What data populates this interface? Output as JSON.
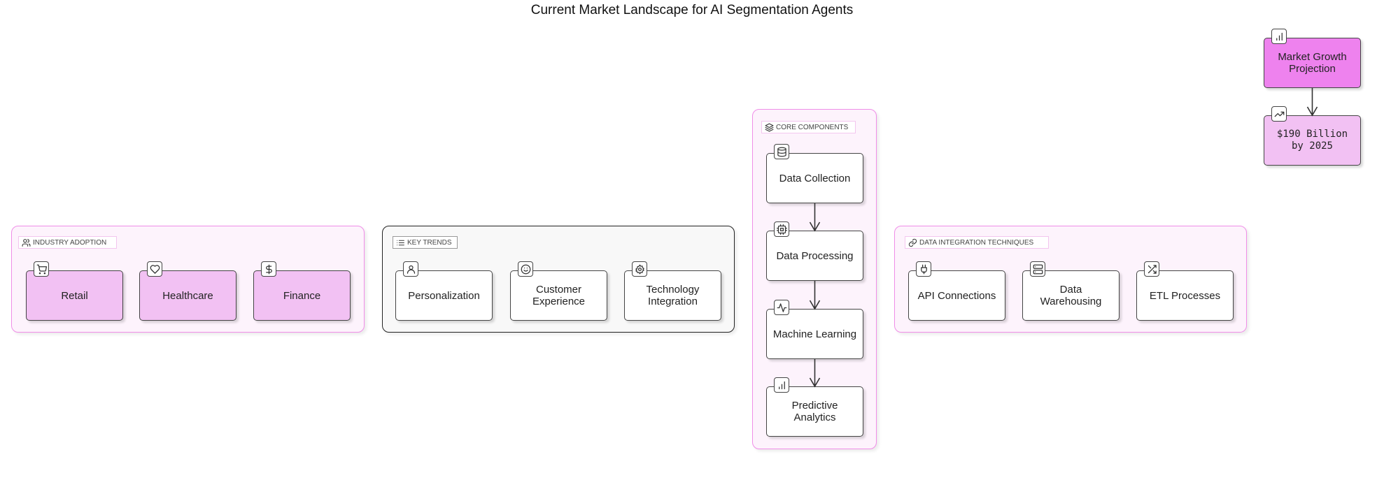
{
  "title": "Current Market Landscape for AI Segmentation Agents",
  "colors": {
    "group_border": "#f08ee8",
    "group_bg": "#fdf3fc",
    "node_pink": "#f2c1f3",
    "node_violet": "#ee82ee",
    "stroke": "#444444"
  },
  "groups": [
    {
      "id": "industry",
      "label": "INDUSTRY ADOPTION",
      "icon": "users-icon",
      "nodes": [
        {
          "label": "Retail",
          "icon": "shopping-cart-icon"
        },
        {
          "label": "Healthcare",
          "icon": "heart-icon"
        },
        {
          "label": "Finance",
          "icon": "dollar-sign-icon"
        }
      ]
    },
    {
      "id": "trends",
      "label": "KEY TRENDS",
      "icon": "list-icon",
      "nodes": [
        {
          "label": "Personalization",
          "icon": "user-icon"
        },
        {
          "label": "Customer Experience",
          "icon": "smile-icon"
        },
        {
          "label": "Technology Integration",
          "icon": "settings-icon"
        }
      ]
    },
    {
      "id": "core",
      "label": "CORE COMPONENTS",
      "icon": "layers-icon",
      "nodes": [
        {
          "label": "Data Collection",
          "icon": "database-icon"
        },
        {
          "label": "Data Processing",
          "icon": "cpu-icon"
        },
        {
          "label": "Machine Learning",
          "icon": "activity-icon"
        },
        {
          "label": "Predictive Analytics",
          "icon": "bar-chart-icon"
        }
      ]
    },
    {
      "id": "integration",
      "label": "DATA INTEGRATION TECHNIQUES",
      "icon": "link-icon",
      "nodes": [
        {
          "label": "API Connections",
          "icon": "plug-icon"
        },
        {
          "label": "Data Warehousing",
          "icon": "server-icon"
        },
        {
          "label": "ETL Processes",
          "icon": "shuffle-icon"
        }
      ]
    }
  ],
  "standalone": [
    {
      "label": "Market Growth Projection",
      "icon": "bar-chart-icon"
    },
    {
      "label": "$190 Billion by 2025",
      "icon": "trending-up-icon"
    }
  ],
  "edges": [
    [
      "Data Collection",
      "Data Processing"
    ],
    [
      "Data Processing",
      "Machine Learning"
    ],
    [
      "Machine Learning",
      "Predictive Analytics"
    ],
    [
      "Market Growth Projection",
      "$190 Billion by 2025"
    ]
  ]
}
